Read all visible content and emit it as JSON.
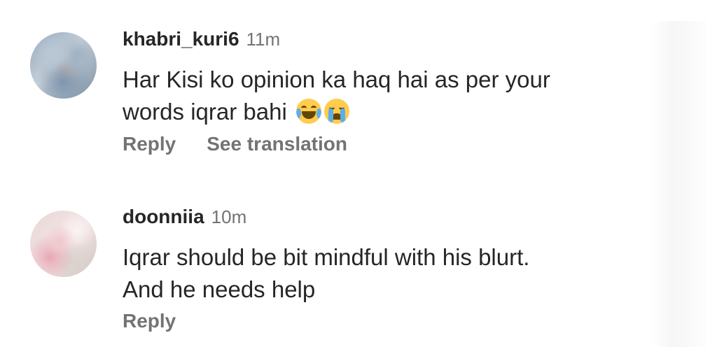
{
  "comments": [
    {
      "username": "khabri_kuri6",
      "timestamp": "11m",
      "text_line1": "Har Kisi ko opinion ka haq hai as per your",
      "text_line2": "words iqrar bahi",
      "emojis": [
        "face-with-tears-of-joy",
        "loudly-crying-face"
      ],
      "reply_label": "Reply",
      "translate_label": "See translation"
    },
    {
      "username": "doonniia",
      "timestamp": "10m",
      "text_line1": "Iqrar should be bit mindful with his blurt.",
      "text_line2": "And he needs help",
      "reply_label": "Reply"
    }
  ],
  "colors": {
    "primary_text": "#262626",
    "secondary_text": "#737373",
    "background": "#ffffff"
  }
}
